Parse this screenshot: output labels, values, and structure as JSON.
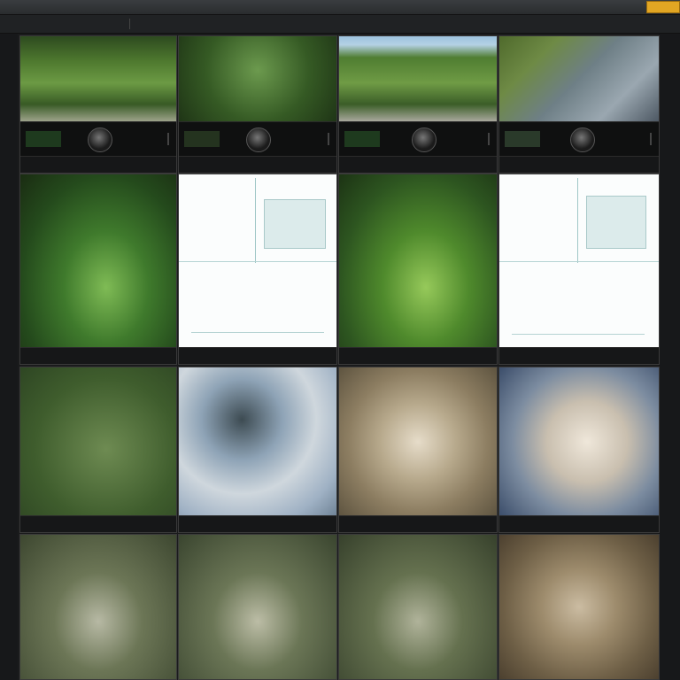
{
  "app": {
    "title": "",
    "topbar_accent_label": ""
  },
  "toolbar": {
    "items": [
      "",
      "",
      "",
      "",
      "",
      ""
    ]
  },
  "tiles": [
    {
      "caption": "",
      "meta": ""
    },
    {
      "caption": "",
      "meta": ""
    },
    {
      "caption": "",
      "meta": ""
    },
    {
      "caption": "",
      "meta": ""
    },
    {
      "caption": "",
      "meta": ""
    },
    {
      "caption": "",
      "meta": ""
    },
    {
      "caption": "",
      "meta": ""
    },
    {
      "caption": "",
      "meta": ""
    },
    {
      "caption": "",
      "meta": ""
    },
    {
      "caption": "",
      "meta": ""
    },
    {
      "caption": "",
      "meta": ""
    },
    {
      "caption": "",
      "meta": ""
    },
    {
      "caption": "",
      "meta": ""
    },
    {
      "caption": "",
      "meta": ""
    },
    {
      "caption": "",
      "meta": ""
    },
    {
      "caption": "",
      "meta": ""
    }
  ],
  "colors": {
    "accent": "#e2a623",
    "background": "#1a1b1c",
    "panel": "#161718"
  }
}
